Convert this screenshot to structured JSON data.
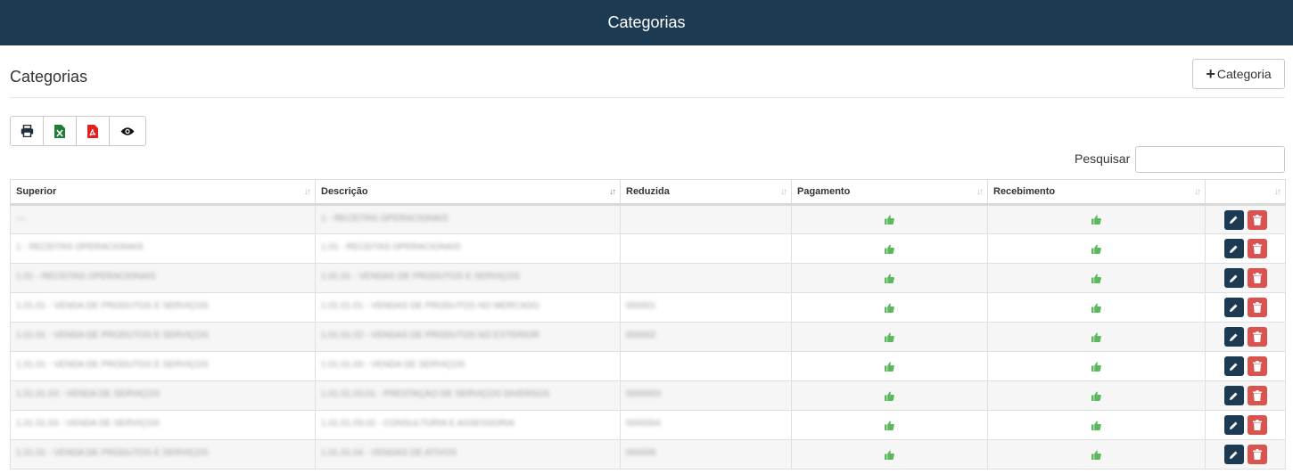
{
  "header": {
    "title": "Categorias"
  },
  "page": {
    "title": "Categorias",
    "add_button_label": "Categoria"
  },
  "toolbar": {
    "icons": [
      "print-icon",
      "excel-icon",
      "pdf-icon",
      "eye-icon"
    ]
  },
  "search": {
    "label": "Pesquisar",
    "value": ""
  },
  "table": {
    "columns": [
      "Superior",
      "Descrição",
      "Reduzida",
      "Pagamento",
      "Recebimento",
      ""
    ],
    "sorted_column": "Descrição",
    "rows": [
      {
        "superior": "—",
        "descricao": "1 - RECEITAS OPERACIONAIS",
        "reduzida": "",
        "pagamento": true,
        "recebimento": true
      },
      {
        "superior": "1 - RECEITAS OPERACIONAIS",
        "descricao": "1.01 - RECEITAS OPERACIONAIS",
        "reduzida": "",
        "pagamento": true,
        "recebimento": true
      },
      {
        "superior": "1.01 - RECEITAS OPERACIONAIS",
        "descricao": "1.01.01 - VENDAS DE PRODUTOS E SERVIÇOS",
        "reduzida": "",
        "pagamento": true,
        "recebimento": true
      },
      {
        "superior": "1.01.01 - VENDA DE PRODUTOS E SERVIÇOS",
        "descricao": "1.01.01.01 - VENDAS DE PRODUTOS NO MERCADO",
        "reduzida": "000001",
        "pagamento": true,
        "recebimento": true
      },
      {
        "superior": "1.01.01 - VENDA DE PRODUTOS E SERVIÇOS",
        "descricao": "1.01.01.02 - VENDAS DE PRODUTOS NO EXTERIOR",
        "reduzida": "000002",
        "pagamento": true,
        "recebimento": true
      },
      {
        "superior": "1.01.01 - VENDA DE PRODUTOS E SERVIÇOS",
        "descricao": "1.01.01.03 - VENDA DE SERVIÇOS",
        "reduzida": "",
        "pagamento": true,
        "recebimento": true
      },
      {
        "superior": "1.01.01.03 - VENDA DE SERVIÇOS",
        "descricao": "1.01.01.03.01 - PRESTAÇÃO DE SERVIÇOS DIVERSOS",
        "reduzida": "0000003",
        "pagamento": true,
        "recebimento": true
      },
      {
        "superior": "1.01.01.03 - VENDA DE SERVIÇOS",
        "descricao": "1.01.01.03.02 - CONSULTORIA E ASSESSORIA",
        "reduzida": "0000004",
        "pagamento": true,
        "recebimento": true
      },
      {
        "superior": "1.01.01 - VENDA DE PRODUTOS E SERVIÇOS",
        "descricao": "1.01.01.04 - VENDAS DE ATIVOS",
        "reduzida": "000005",
        "pagamento": true,
        "recebimento": true
      }
    ]
  },
  "colors": {
    "header_bg": "#1c3a52",
    "thumb": "#5cb85c",
    "edit": "#1c3a52",
    "delete": "#d9534f"
  }
}
